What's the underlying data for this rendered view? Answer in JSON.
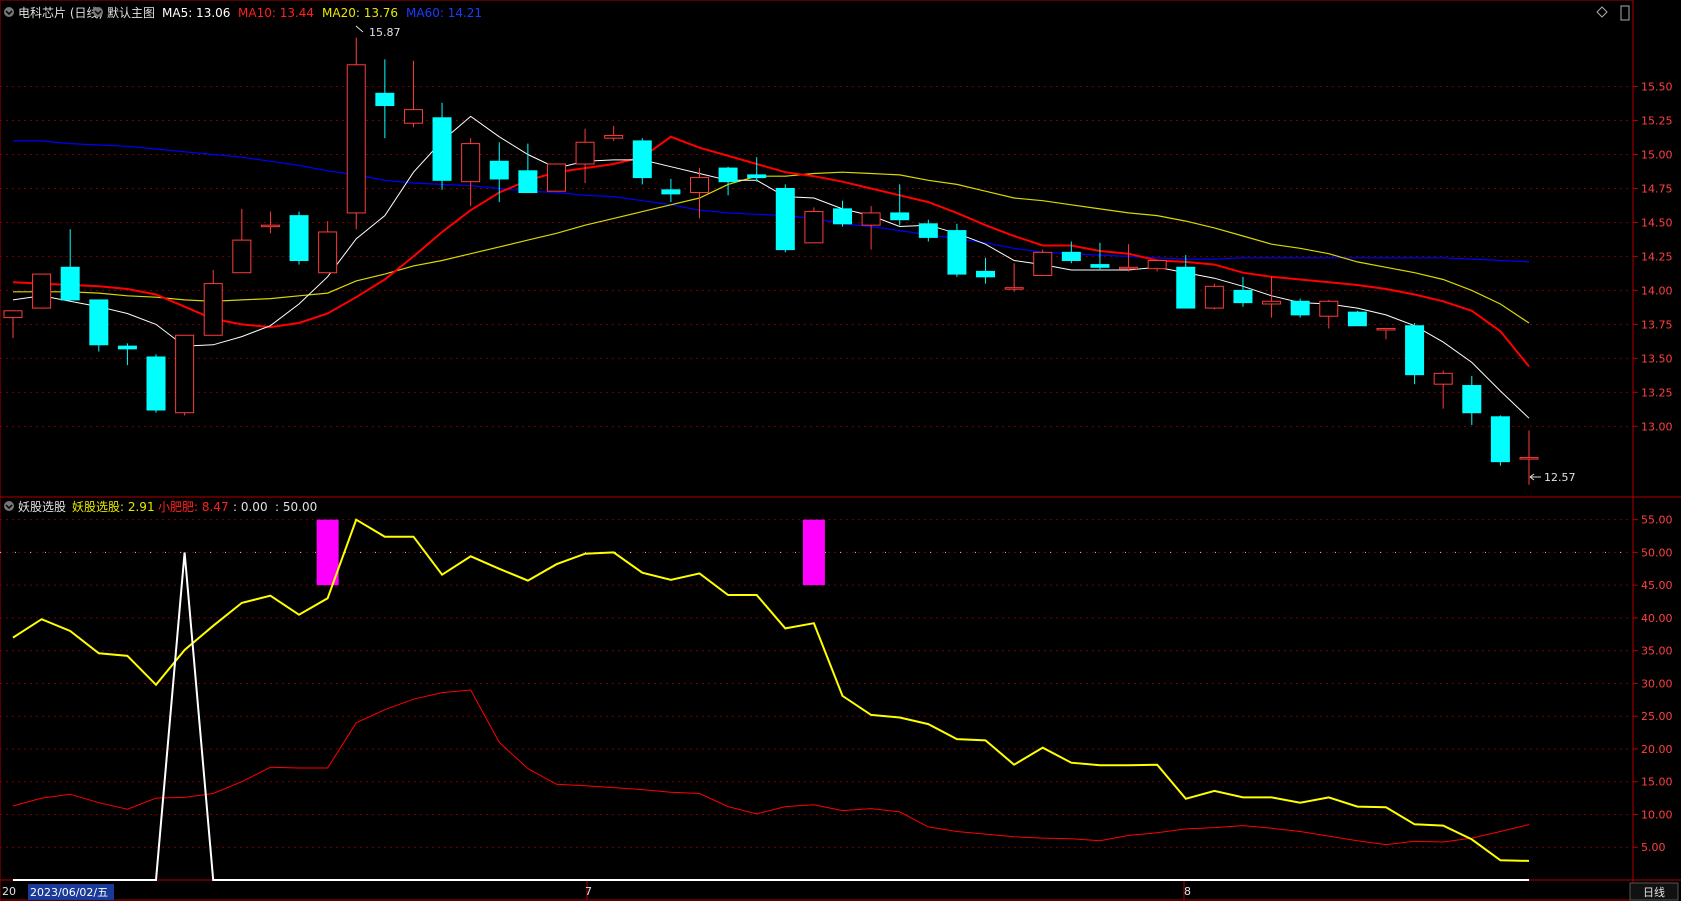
{
  "header": {
    "circle_icon": "circle-icon",
    "stock_title": "电科芯片 (日线)",
    "template_label": "默认主图",
    "ma5_label": "MA5: 13.06",
    "ma10_label": "MA10: 13.44",
    "ma20_label": "MA20: 13.76",
    "ma60_label": "MA60: 14.21",
    "diamond_icon": "diamond-icon",
    "scroll_icon": "scroll-icon"
  },
  "indicator_header": {
    "name": "妖股选股",
    "l1": "妖股选股: 2.91",
    "l2": "小肥肥: 8.47",
    "l3": ": 0.00",
    "l4": ": 50.00"
  },
  "colors": {
    "up": "#ff3b3b",
    "down": "#00ffff",
    "ma5": "#ffffff",
    "ma10": "#ff0000",
    "ma20": "#d8d800",
    "ma60": "#0000ff",
    "magenta": "#ff00ff",
    "grid": "#7a0000",
    "axis": "#b00000"
  },
  "price_axis": {
    "ticks": [
      "15.50",
      "15.25",
      "15.00",
      "14.75",
      "14.50",
      "14.25",
      "14.00",
      "13.75",
      "13.50",
      "13.25",
      "13.00"
    ]
  },
  "ind_axis": {
    "ticks": [
      "55.00",
      "50.00",
      "45.00",
      "40.00",
      "35.00",
      "30.00",
      "25.00",
      "20.00",
      "15.00",
      "10.00",
      "5.00"
    ]
  },
  "annotations": {
    "high": "15.87",
    "low": "12.57"
  },
  "bottom_axis": {
    "first": "20",
    "selected_date": "2023/06/02/五",
    "m7": "7",
    "m8": "8",
    "period": "日线"
  },
  "chart_data": {
    "type": "candlestick",
    "candles": [
      [
        13.8,
        13.85,
        13.65,
        13.85
      ],
      [
        13.87,
        14.12,
        13.87,
        14.12
      ],
      [
        14.17,
        14.45,
        13.93,
        13.93
      ],
      [
        13.93,
        13.9,
        13.55,
        13.6
      ],
      [
        13.59,
        13.61,
        13.45,
        13.57
      ],
      [
        13.51,
        13.53,
        13.1,
        13.12
      ],
      [
        13.1,
        13.65,
        13.08,
        13.67
      ],
      [
        13.67,
        14.15,
        13.67,
        14.05
      ],
      [
        14.13,
        14.6,
        14.13,
        14.37
      ],
      [
        14.48,
        14.58,
        14.42,
        14.48
      ],
      [
        14.55,
        14.58,
        14.19,
        14.22
      ],
      [
        14.13,
        14.51,
        14.13,
        14.43
      ],
      [
        14.57,
        15.86,
        14.45,
        15.66
      ],
      [
        15.45,
        15.7,
        15.12,
        15.36
      ],
      [
        15.23,
        15.69,
        15.2,
        15.33
      ],
      [
        15.27,
        15.38,
        14.74,
        14.81
      ],
      [
        14.8,
        15.12,
        14.62,
        15.08
      ],
      [
        14.95,
        15.09,
        14.65,
        14.82
      ],
      [
        14.88,
        15.08,
        14.72,
        14.72
      ],
      [
        14.73,
        14.93,
        14.73,
        14.93
      ],
      [
        14.93,
        15.19,
        14.79,
        15.09
      ],
      [
        15.12,
        15.21,
        15.1,
        15.14
      ],
      [
        15.1,
        15.12,
        14.78,
        14.83
      ],
      [
        14.74,
        14.82,
        14.65,
        14.71
      ],
      [
        14.72,
        14.9,
        14.53,
        14.83
      ],
      [
        14.9,
        14.91,
        14.7,
        14.8
      ],
      [
        14.85,
        14.98,
        14.8,
        14.83
      ],
      [
        14.75,
        14.78,
        14.28,
        14.3
      ],
      [
        14.35,
        14.61,
        14.35,
        14.58
      ],
      [
        14.6,
        14.66,
        14.47,
        14.49
      ],
      [
        14.48,
        14.62,
        14.3,
        14.57
      ],
      [
        14.57,
        14.78,
        14.48,
        14.52
      ],
      [
        14.49,
        14.52,
        14.36,
        14.39
      ],
      [
        14.44,
        14.49,
        14.1,
        14.12
      ],
      [
        14.14,
        14.24,
        14.05,
        14.1
      ],
      [
        14.01,
        14.2,
        13.99,
        14.02
      ],
      [
        14.11,
        14.3,
        14.11,
        14.28
      ],
      [
        14.28,
        14.36,
        14.2,
        14.22
      ],
      [
        14.19,
        14.35,
        14.15,
        14.17
      ],
      [
        14.17,
        14.34,
        14.14,
        14.17
      ],
      [
        14.16,
        14.22,
        14.14,
        14.22
      ],
      [
        14.17,
        14.26,
        13.87,
        13.87
      ],
      [
        13.87,
        14.05,
        13.86,
        14.03
      ],
      [
        14.0,
        14.1,
        13.88,
        13.91
      ],
      [
        13.9,
        14.1,
        13.8,
        13.92
      ],
      [
        13.92,
        13.94,
        13.8,
        13.82
      ],
      [
        13.81,
        13.93,
        13.72,
        13.92
      ],
      [
        13.84,
        13.85,
        13.74,
        13.74
      ],
      [
        13.72,
        13.72,
        13.64,
        13.72
      ],
      [
        13.74,
        13.76,
        13.31,
        13.38
      ],
      [
        13.31,
        13.41,
        13.13,
        13.39
      ],
      [
        13.3,
        13.37,
        13.01,
        13.1
      ],
      [
        13.07,
        13.08,
        12.71,
        12.74
      ],
      [
        12.77,
        12.97,
        12.57,
        12.77
      ]
    ],
    "ma5": [
      13.93,
      13.96,
      13.92,
      13.88,
      13.83,
      13.75,
      13.59,
      13.6,
      13.66,
      13.74,
      13.9,
      14.1,
      14.38,
      14.55,
      14.87,
      15.1,
      15.28,
      15.13,
      15.0,
      14.9,
      14.95,
      14.96,
      14.96,
      14.91,
      14.86,
      14.81,
      14.81,
      14.69,
      14.68,
      14.6,
      14.55,
      14.47,
      14.48,
      14.42,
      14.34,
      14.22,
      14.19,
      14.15,
      14.15,
      14.15,
      14.17,
      14.13,
      14.09,
      14.03,
      13.96,
      13.91,
      13.9,
      13.87,
      13.82,
      13.74,
      13.62,
      13.47,
      13.26,
      13.06
    ],
    "ma10": [
      14.06,
      14.05,
      14.04,
      14.03,
      14.01,
      13.97,
      13.88,
      13.79,
      13.75,
      13.73,
      13.76,
      13.83,
      13.95,
      14.08,
      14.25,
      14.43,
      14.59,
      14.72,
      14.81,
      14.87,
      14.9,
      14.93,
      14.98,
      15.13,
      15.05,
      14.99,
      14.93,
      14.87,
      14.84,
      14.8,
      14.75,
      14.7,
      14.65,
      14.57,
      14.48,
      14.4,
      14.33,
      14.33,
      14.29,
      14.27,
      14.22,
      14.21,
      14.19,
      14.13,
      14.1,
      14.08,
      14.06,
      14.04,
      14.01,
      13.97,
      13.92,
      13.85,
      13.7,
      13.44
    ],
    "ma20": [
      13.99,
      13.99,
      13.99,
      13.98,
      13.96,
      13.95,
      13.93,
      13.92,
      13.93,
      13.94,
      13.96,
      13.98,
      14.07,
      14.12,
      14.18,
      14.22,
      14.27,
      14.32,
      14.37,
      14.42,
      14.48,
      14.53,
      14.58,
      14.63,
      14.68,
      14.78,
      14.84,
      14.84,
      14.86,
      14.87,
      14.86,
      14.85,
      14.81,
      14.78,
      14.73,
      14.68,
      14.66,
      14.63,
      14.6,
      14.57,
      14.55,
      14.51,
      14.46,
      14.4,
      14.34,
      14.31,
      14.27,
      14.21,
      14.17,
      14.13,
      14.08,
      14.0,
      13.9,
      13.76
    ],
    "ma60": [
      15.1,
      15.1,
      15.08,
      15.07,
      15.06,
      15.04,
      15.02,
      15.0,
      14.98,
      14.95,
      14.92,
      14.88,
      14.85,
      14.81,
      14.79,
      14.78,
      14.77,
      14.75,
      14.73,
      14.72,
      14.7,
      14.69,
      14.66,
      14.63,
      14.59,
      14.57,
      14.56,
      14.55,
      14.53,
      14.49,
      14.47,
      14.44,
      14.41,
      14.38,
      14.35,
      14.31,
      14.28,
      14.27,
      14.26,
      14.25,
      14.24,
      14.23,
      14.23,
      14.24,
      14.24,
      14.24,
      14.24,
      14.24,
      14.24,
      14.24,
      14.24,
      14.23,
      14.22,
      14.21
    ],
    "yao": [
      37.0,
      39.8,
      38.0,
      34.6,
      34.2,
      29.8,
      35.1,
      38.8,
      42.3,
      43.4,
      40.5,
      43.0,
      55.0,
      52.4,
      52.4,
      46.6,
      49.4,
      47.5,
      45.7,
      48.2,
      49.8,
      50.0,
      46.9,
      45.8,
      46.8,
      43.5,
      43.5,
      38.4,
      39.2,
      28.1,
      25.2,
      24.8,
      23.8,
      21.5,
      21.3,
      17.6,
      20.2,
      17.9,
      17.5,
      17.5,
      17.6,
      12.4,
      13.6,
      12.6,
      12.6,
      11.8,
      12.6,
      11.2,
      11.1,
      8.5,
      8.3,
      6.2,
      3.0,
      2.91
    ],
    "xff": [
      11.3,
      12.5,
      13.1,
      11.8,
      10.8,
      12.5,
      12.6,
      13.2,
      15.0,
      17.2,
      17.1,
      17.1,
      24.0,
      26.0,
      27.6,
      28.6,
      29.0,
      21.0,
      17.0,
      14.6,
      14.4,
      14.1,
      13.8,
      13.4,
      13.2,
      11.2,
      10.1,
      11.2,
      11.5,
      10.6,
      10.9,
      10.4,
      8.1,
      7.4,
      7.0,
      6.6,
      6.4,
      6.3,
      6.0,
      6.8,
      7.2,
      7.8,
      8.0,
      8.3,
      7.9,
      7.4,
      6.7,
      6.0,
      5.4,
      5.9,
      5.8,
      6.4,
      7.4,
      8.47
    ],
    "spike": [
      0,
      0,
      0,
      0,
      0,
      0,
      50,
      0,
      0,
      0,
      0,
      0,
      0,
      0,
      0,
      0,
      0,
      0,
      0,
      0,
      0,
      0,
      0,
      0,
      0,
      0,
      0,
      0,
      0,
      0,
      0,
      0,
      0,
      0,
      0,
      0,
      0,
      0,
      0,
      0,
      0,
      0,
      0,
      0,
      0,
      0,
      0,
      0,
      0,
      0,
      0,
      0,
      0,
      0
    ],
    "ref_level": 50,
    "signals": [
      {
        "index": 11,
        "from": 45,
        "to": 55
      },
      {
        "index": 28,
        "from": 45,
        "to": 55
      }
    ],
    "price_range": [
      12.48,
      15.96
    ],
    "indicator_range": [
      0,
      58
    ]
  }
}
